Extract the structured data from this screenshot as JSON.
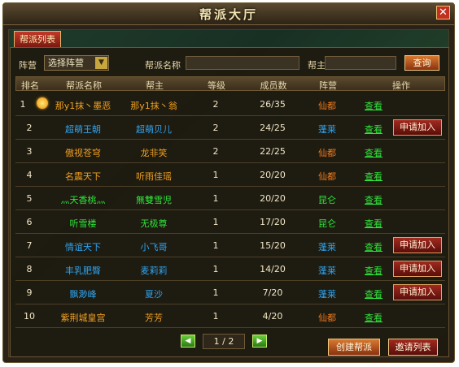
{
  "window": {
    "title": "帮派大厅",
    "close_label": "✕"
  },
  "tab": {
    "label": "帮派列表"
  },
  "filter": {
    "camp_label": "阵营",
    "camp_select_value": "选择阵营",
    "guild_name_label": "帮派名称",
    "guild_name_value": "",
    "leader_label": "帮主",
    "leader_value": "",
    "search_button": "查询"
  },
  "table": {
    "headers": [
      "排名",
      "帮派名称",
      "帮主",
      "等级",
      "成员数",
      "阵营",
      "操作"
    ],
    "view_label": "查看",
    "apply_label": "申请加入",
    "rows": [
      {
        "rank": "1",
        "name": "那y1抹丶墨恶",
        "leader": "那y1抹丶翁",
        "level": "2",
        "members": "26/35",
        "camp": "仙都",
        "apply": false,
        "top": true
      },
      {
        "rank": "2",
        "name": "超萌王朝",
        "leader": "超萌贝儿",
        "level": "2",
        "members": "24/25",
        "camp": "蓬莱",
        "apply": true
      },
      {
        "rank": "3",
        "name": "傲视苍穹",
        "leader": "龙非笑",
        "level": "2",
        "members": "22/25",
        "camp": "仙都",
        "apply": false
      },
      {
        "rank": "4",
        "name": "名震天下",
        "leader": "听雨佳瑶",
        "level": "1",
        "members": "20/20",
        "camp": "仙都",
        "apply": false
      },
      {
        "rank": "5",
        "name": "灬天香桃灬",
        "leader": "無雙雪児",
        "level": "1",
        "members": "20/20",
        "camp": "昆仑",
        "apply": false
      },
      {
        "rank": "6",
        "name": "听雪楼",
        "leader": "无极尊",
        "level": "1",
        "members": "17/20",
        "camp": "昆仑",
        "apply": false
      },
      {
        "rank": "7",
        "name": "情谊天下",
        "leader": "小飞哥",
        "level": "1",
        "members": "15/20",
        "camp": "蓬莱",
        "apply": true
      },
      {
        "rank": "8",
        "name": "丰乳肥臀",
        "leader": "麦莉莉",
        "level": "1",
        "members": "14/20",
        "camp": "蓬莱",
        "apply": true
      },
      {
        "rank": "9",
        "name": "飘渺峰",
        "leader": "夏沙",
        "level": "1",
        "members": "7/20",
        "camp": "蓬莱",
        "apply": true
      },
      {
        "rank": "10",
        "name": "紫荆城皇宫",
        "leader": "芳芳",
        "level": "1",
        "members": "4/20",
        "camp": "仙都",
        "apply": false
      }
    ]
  },
  "pager": {
    "prev": "◀",
    "page_display": "1 / 2",
    "next": "▶"
  },
  "footer": {
    "create_guild": "创建帮派",
    "invite_list": "邀请列表"
  },
  "colors": {
    "name_by_camp": {
      "仙都": "#f0a020",
      "蓬莱": "#2fa4f0",
      "昆仑": "#2ee63a"
    },
    "camp_text": {
      "仙都": "#f07a1a",
      "蓬莱": "#2fa4f0",
      "昆仑": "#2ee63a"
    }
  }
}
